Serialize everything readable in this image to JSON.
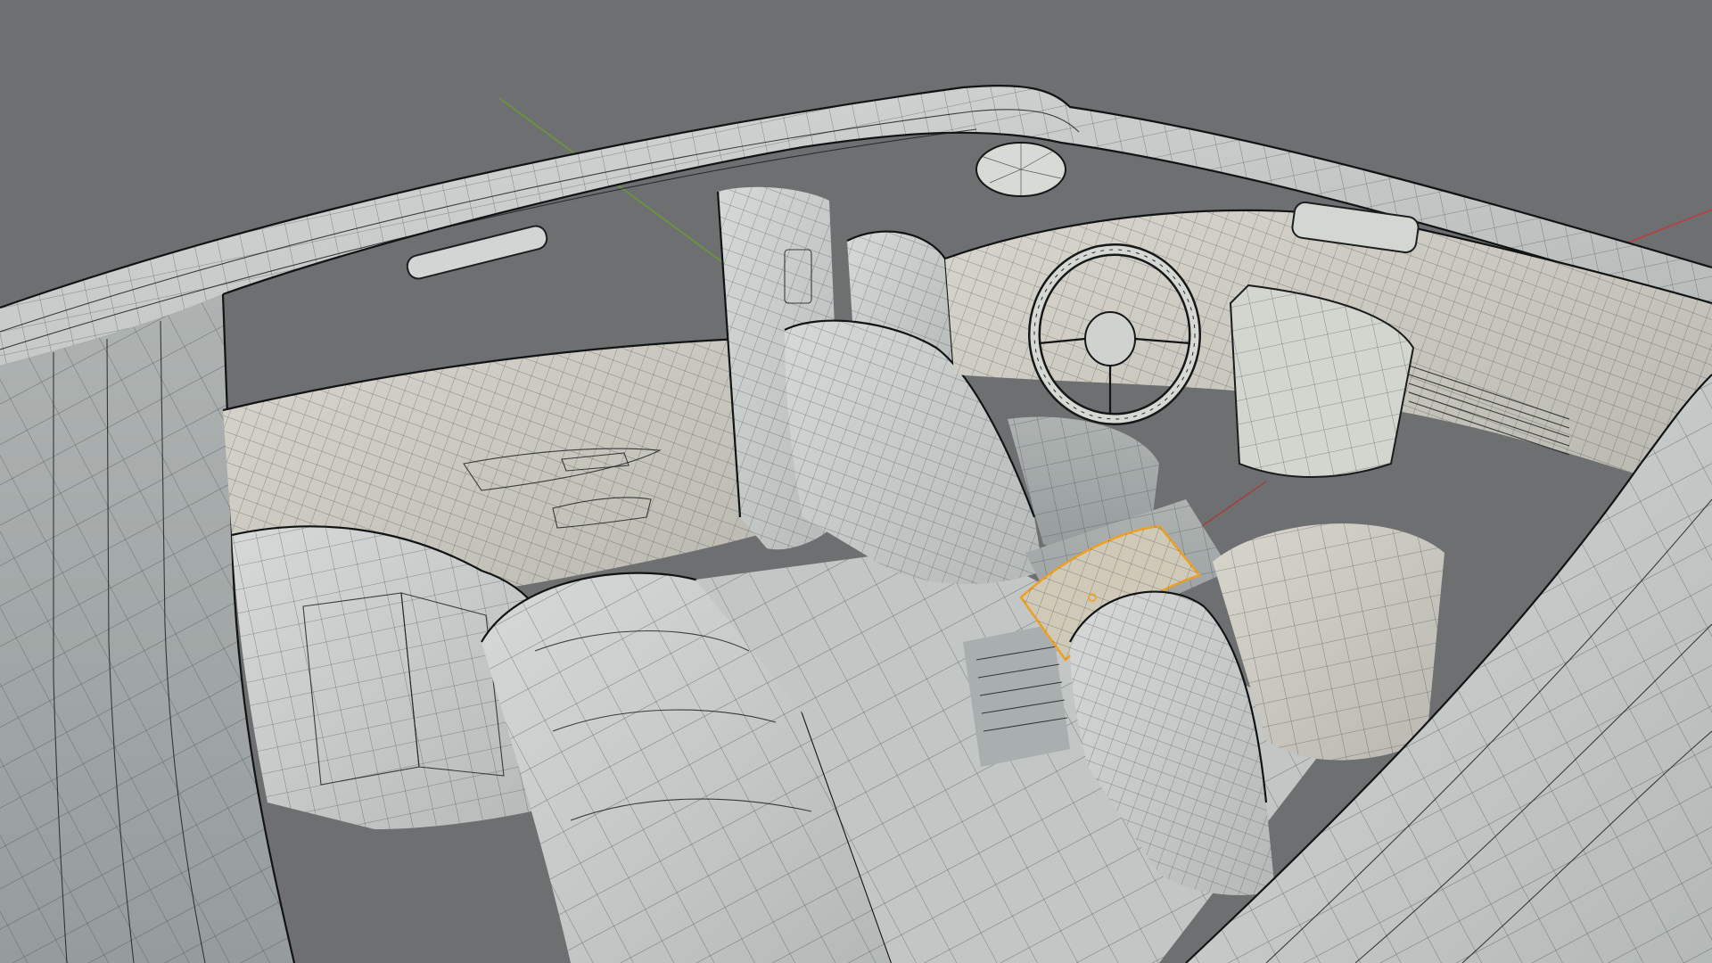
{
  "viewport": {
    "mode": "wireframe-overlay",
    "background_color": "#6e6f70",
    "surface_color": "#c9cdcb",
    "selection_color": "#f0a020",
    "axis_x_color": "#c23a3a",
    "axis_y_color": "#6a9a35"
  },
  "scene": {
    "subject": "car-interior-mesh",
    "selected_part": "center-console-lid"
  }
}
